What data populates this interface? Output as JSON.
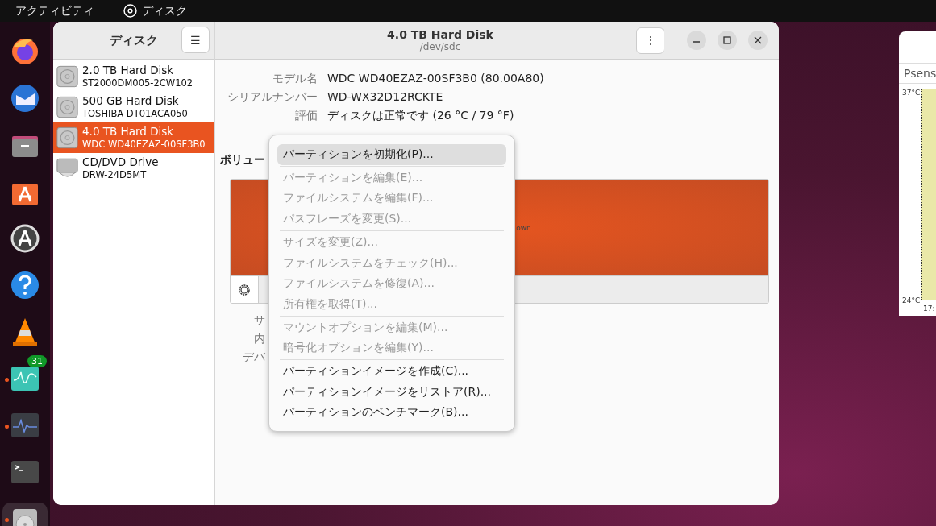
{
  "top_bar": {
    "activities": "アクティビティ",
    "app_name": "ディスク"
  },
  "dock": [
    {
      "kind": "firefox",
      "running": false,
      "selected": false
    },
    {
      "kind": "mail",
      "running": false,
      "selected": false
    },
    {
      "kind": "files",
      "running": false,
      "selected": false
    },
    {
      "kind": "store",
      "running": false,
      "selected": false
    },
    {
      "kind": "updater",
      "running": false,
      "selected": false
    },
    {
      "kind": "help",
      "running": false,
      "selected": false
    },
    {
      "kind": "cone",
      "running": false,
      "selected": false
    },
    {
      "kind": "wave",
      "running": true,
      "selected": false,
      "badge": "31"
    },
    {
      "kind": "monitor",
      "running": true,
      "selected": false
    },
    {
      "kind": "terminal",
      "running": false,
      "selected": false
    },
    {
      "kind": "disk",
      "running": true,
      "selected": true
    }
  ],
  "sidebar": {
    "title": "ディスク",
    "menu_button": "☰",
    "items": [
      {
        "kind": "disk",
        "name": "2.0 TB Hard Disk",
        "model": "ST2000DM005-2CW102",
        "selected": false
      },
      {
        "kind": "disk",
        "name": "500 GB Hard Disk",
        "model": "TOSHIBA DT01ACA050",
        "selected": false
      },
      {
        "kind": "disk",
        "name": "4.0 TB Hard Disk",
        "model": "WDC WD40EZAZ-00SF3B0",
        "selected": true
      },
      {
        "kind": "optical",
        "name": "CD/DVD Drive",
        "model": "DRW-24D5MT",
        "selected": false
      }
    ]
  },
  "header": {
    "title": "4.0 TB Hard Disk",
    "subtitle": "/dev/sdc",
    "more_button": "⋮"
  },
  "details": [
    {
      "label": "モデル名",
      "value": "WDC WD40EZAZ-00SF3B0 (80.00A80)"
    },
    {
      "label": "シリアルナンバー",
      "value": "WD-WX32D12RCKTE"
    },
    {
      "label": "評価",
      "value": "ディスクは正常です (26 °C / 79 °F)"
    }
  ],
  "volumes": {
    "heading": "ボリュー",
    "partition_text": "own",
    "fields": [
      "サ",
      "内",
      "デバ"
    ]
  },
  "context_menu": [
    {
      "kind": "item",
      "label": "パーティションを初期化(P)...",
      "disabled": false,
      "selected": true
    },
    {
      "kind": "separator"
    },
    {
      "kind": "item",
      "label": "パーティションを編集(E)...",
      "disabled": true,
      "selected": false
    },
    {
      "kind": "item",
      "label": "ファイルシステムを編集(F)...",
      "disabled": true,
      "selected": false
    },
    {
      "kind": "item",
      "label": "パスフレーズを変更(S)...",
      "disabled": true,
      "selected": false
    },
    {
      "kind": "separator"
    },
    {
      "kind": "item",
      "label": "サイズを変更(Z)...",
      "disabled": true,
      "selected": false
    },
    {
      "kind": "item",
      "label": "ファイルシステムをチェック(H)...",
      "disabled": true,
      "selected": false
    },
    {
      "kind": "item",
      "label": "ファイルシステムを修復(A)...",
      "disabled": true,
      "selected": false
    },
    {
      "kind": "item",
      "label": "所有権を取得(T)...",
      "disabled": true,
      "selected": false
    },
    {
      "kind": "separator"
    },
    {
      "kind": "item",
      "label": "マウントオプションを編集(M)...",
      "disabled": true,
      "selected": false
    },
    {
      "kind": "item",
      "label": "暗号化オプションを編集(Y)...",
      "disabled": true,
      "selected": false
    },
    {
      "kind": "separator"
    },
    {
      "kind": "item",
      "label": "パーティションイメージを作成(C)...",
      "disabled": false,
      "selected": false
    },
    {
      "kind": "item",
      "label": "パーティションイメージをリストア(R)...",
      "disabled": false,
      "selected": false
    },
    {
      "kind": "item",
      "label": "パーティションのベンチマーク(B)...",
      "disabled": false,
      "selected": false
    }
  ],
  "side_window": {
    "tab": "Psens",
    "y_top": "37°C",
    "y_bottom": "24°C",
    "x_label": "17:"
  }
}
